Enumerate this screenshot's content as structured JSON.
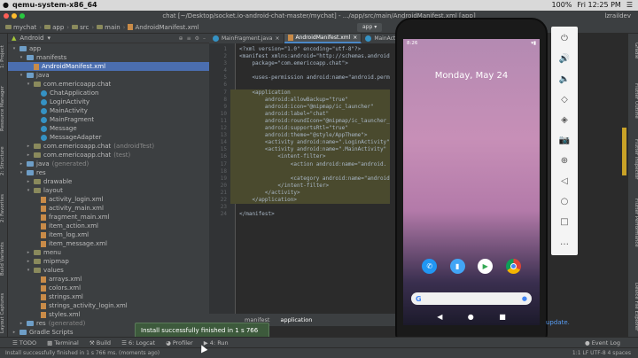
{
  "mac": {
    "app": "qemu-system-x86_64",
    "right": [
      "100%",
      "Fri 12:25 PM",
      "☰"
    ]
  },
  "window": {
    "title": "chat [~/Desktop/socket.io-android-chat-master/mychat] - .../app/src/main/AndroidManifest.xml [app]",
    "user": "lzraildev"
  },
  "breadcrumbs": [
    "mychat",
    "app",
    "src",
    "main",
    "AndroidManifest.xml"
  ],
  "run_config": "app",
  "left_tabs": [
    "1: Project",
    "Resource Manager",
    "2: Structure",
    "2: Favorites",
    "Build Variants",
    "Layout Captures"
  ],
  "project": {
    "view": "Android",
    "tree": [
      {
        "label": "app",
        "level": 0,
        "icon": "folder",
        "arrow": "▾"
      },
      {
        "label": "manifests",
        "level": 1,
        "icon": "folder",
        "arrow": "▾"
      },
      {
        "label": "AndroidManifest.xml",
        "level": 2,
        "icon": "xml",
        "selected": true
      },
      {
        "label": "java",
        "level": 1,
        "icon": "folder",
        "arrow": "▾"
      },
      {
        "label": "com.emericoapp.chat",
        "level": 2,
        "icon": "folder",
        "arrow": "▾"
      },
      {
        "label": "ChatApplication",
        "level": 3,
        "icon": "class"
      },
      {
        "label": "LoginActivity",
        "level": 3,
        "icon": "class"
      },
      {
        "label": "MainActivity",
        "level": 3,
        "icon": "class"
      },
      {
        "label": "MainFragment",
        "level": 3,
        "icon": "class"
      },
      {
        "label": "Message",
        "level": 3,
        "icon": "class"
      },
      {
        "label": "MessageAdapter",
        "level": 3,
        "icon": "class"
      },
      {
        "label": "com.emericoapp.chat",
        "suffix": "(androidTest)",
        "level": 2,
        "icon": "folder",
        "arrow": "▸"
      },
      {
        "label": "com.emericoapp.chat",
        "suffix": "(test)",
        "level": 2,
        "icon": "folder",
        "arrow": "▸"
      },
      {
        "label": "java",
        "suffix": "(generated)",
        "level": 1,
        "icon": "folder",
        "arrow": "▸"
      },
      {
        "label": "res",
        "level": 1,
        "icon": "folder",
        "arrow": "▾"
      },
      {
        "label": "drawable",
        "level": 2,
        "icon": "folder",
        "arrow": "▸"
      },
      {
        "label": "layout",
        "level": 2,
        "icon": "folder",
        "arrow": "▾"
      },
      {
        "label": "activity_login.xml",
        "level": 3,
        "icon": "xml"
      },
      {
        "label": "activity_main.xml",
        "level": 3,
        "icon": "xml"
      },
      {
        "label": "fragment_main.xml",
        "level": 3,
        "icon": "xml"
      },
      {
        "label": "item_action.xml",
        "level": 3,
        "icon": "xml"
      },
      {
        "label": "item_log.xml",
        "level": 3,
        "icon": "xml"
      },
      {
        "label": "item_message.xml",
        "level": 3,
        "icon": "xml"
      },
      {
        "label": "menu",
        "level": 2,
        "icon": "folder",
        "arrow": "▸"
      },
      {
        "label": "mipmap",
        "level": 2,
        "icon": "folder",
        "arrow": "▸"
      },
      {
        "label": "values",
        "level": 2,
        "icon": "folder",
        "arrow": "▾"
      },
      {
        "label": "arrays.xml",
        "level": 3,
        "icon": "xml"
      },
      {
        "label": "colors.xml",
        "level": 3,
        "icon": "xml"
      },
      {
        "label": "strings.xml",
        "level": 3,
        "icon": "xml"
      },
      {
        "label": "strings_activity_login.xml",
        "level": 3,
        "icon": "xml"
      },
      {
        "label": "styles.xml",
        "level": 3,
        "icon": "xml"
      },
      {
        "label": "res",
        "suffix": "(generated)",
        "level": 1,
        "icon": "folder",
        "arrow": "▸"
      },
      {
        "label": "Gradle Scripts",
        "level": 0,
        "icon": "folder",
        "arrow": "▸"
      }
    ]
  },
  "editor": {
    "tabs": [
      {
        "label": "MainFragment.java",
        "active": false
      },
      {
        "label": "AndroidManifest.xml",
        "active": true
      },
      {
        "label": "MainActi",
        "active": false
      }
    ],
    "lines": [
      "<?xml version=\"1.0\" encoding=\"utf-8\"?>",
      "<manifest xmlns:android=\"http://schemas.android",
      "    package=\"com.emericoapp.chat\">",
      "",
      "    <uses-permission android:name=\"android.perm",
      "",
      "    <application",
      "        android:allowBackup=\"true\"",
      "        android:icon=\"@mipmap/ic_launcher\"",
      "        android:label=\"chat\"",
      "        android:roundIcon=\"@mipmap/ic_launcher_",
      "        android:supportsRtl=\"true\"",
      "        android:theme=\"@style/AppTheme\">",
      "        <activity android:name=\".LoginActivity\"",
      "        <activity android:name=\".MainActivity\"",
      "            <intent-filter>",
      "                <action android:name=\"android.",
      "",
      "                <category android:name=\"android",
      "            </intent-filter>",
      "        </activity>",
      "    </application>",
      "",
      "</manifest>"
    ],
    "bottom_tabs": [
      "manifest",
      "application"
    ],
    "bottom_tab_overlay": "Manifest"
  },
  "phone": {
    "time": "8:26",
    "date": "Monday, May 24",
    "google": "G",
    "apps": [
      "phone-icon",
      "messages-icon",
      "play-store-icon",
      "chrome-icon"
    ],
    "nav": [
      "◀",
      "●",
      "■"
    ]
  },
  "emu_controls": [
    "⏻",
    "🔊",
    "🔈",
    "◇",
    "◈",
    "📷",
    "⊕",
    "◁",
    "○",
    "□",
    "…"
  ],
  "right_tabs": [
    "Gradle",
    "Flutter Outline",
    "Flutter Inspector",
    "Flutter Performance",
    "Device File Explorer"
  ],
  "tools": [
    "TODO",
    "Terminal",
    "Build",
    "6: Logcat",
    "Profiler",
    "4: Run"
  ],
  "event_log": "Event Log",
  "toast": "Install successfully finished in 1 s 766 ms.",
  "status": "Install successfully finished in 1 s 766 ms. (moments ago)",
  "status_right": "1:1  LF  UTF-8  4 spaces",
  "update_link": "update."
}
